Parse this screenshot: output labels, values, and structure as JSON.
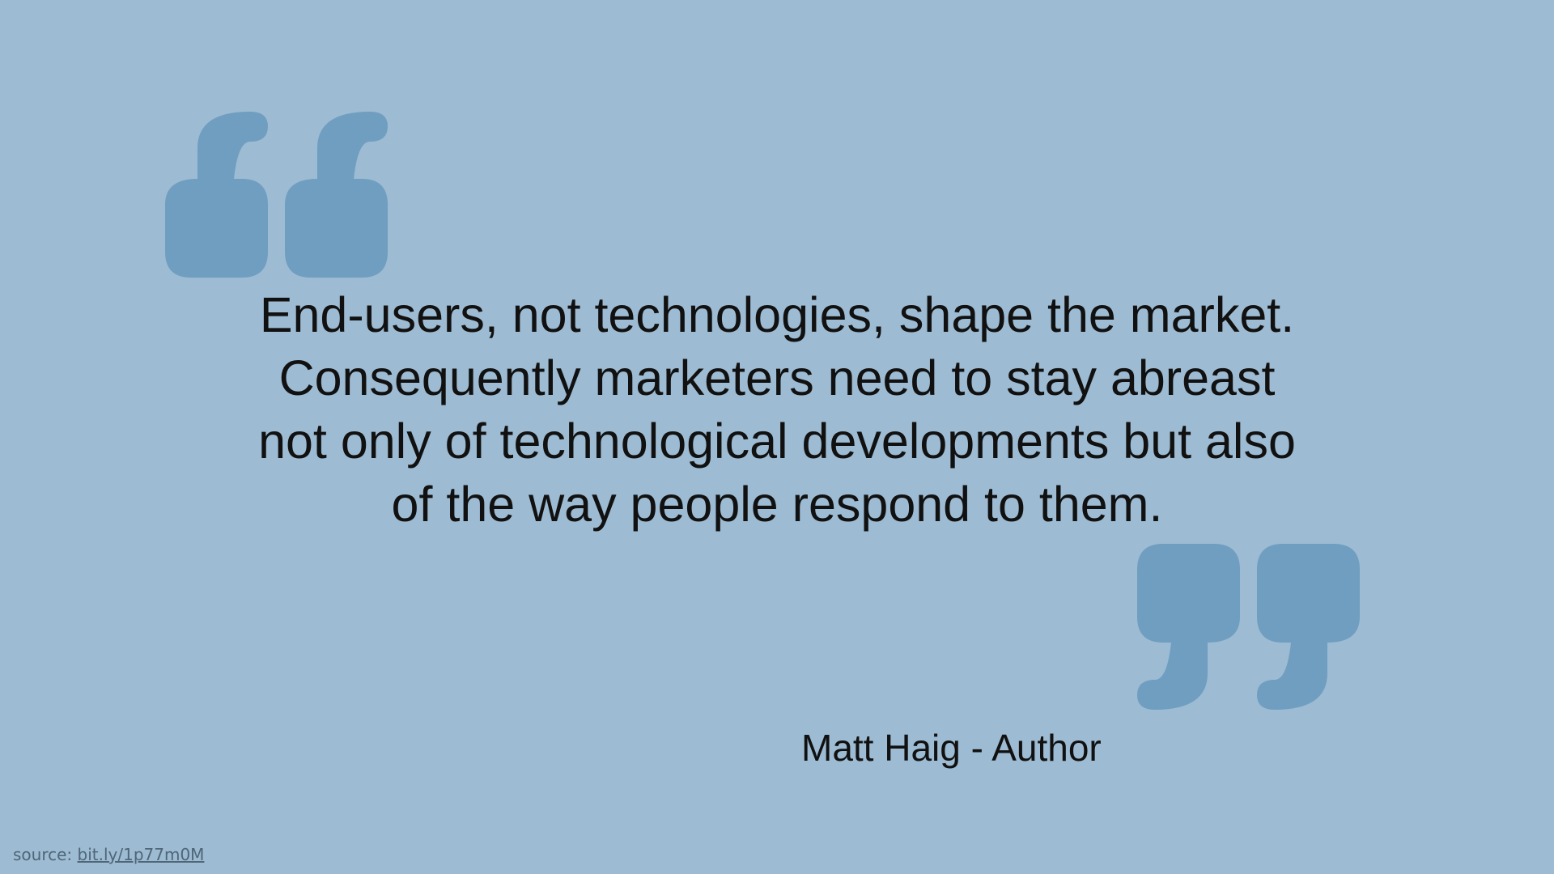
{
  "colors": {
    "background": "#9dbbd2",
    "quote_mark": "#6f9ec0",
    "text": "#111111",
    "source_text": "#4e6677"
  },
  "icons": {
    "open_quote": "open-quote-icon",
    "close_quote": "close-quote-icon"
  },
  "quote": {
    "lines": [
      "End-users, not technologies, shape the market.",
      "Consequently marketers need to stay abreast",
      "not only of technological developments but also",
      "of the way people respond to them."
    ]
  },
  "attribution": "Matt Haig - Author",
  "source": {
    "label": "source:",
    "link_text": "bit.ly/1p77m0M"
  }
}
